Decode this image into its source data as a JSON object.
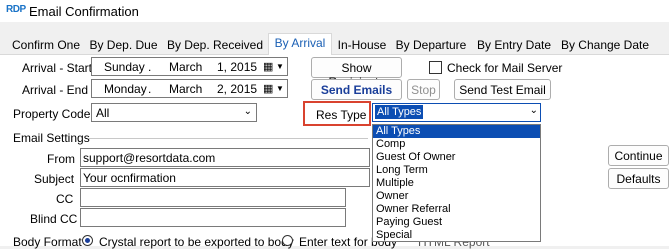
{
  "window": {
    "title": "Email Confirmation",
    "logo": "RDP"
  },
  "tabs": [
    {
      "label": "Confirm One"
    },
    {
      "label": "By Dep. Due"
    },
    {
      "label": "By Dep. Received"
    },
    {
      "label": "By Arrival"
    },
    {
      "label": "In-House"
    },
    {
      "label": "By Departure"
    },
    {
      "label": "By Entry Date"
    },
    {
      "label": "By Change Date"
    }
  ],
  "filters": {
    "arrival_start_label": "Arrival - Start",
    "arrival_start": {
      "weekday": "Sunday",
      "month": "March",
      "day": "1, 2015"
    },
    "arrival_end_label": "Arrival - End",
    "arrival_end": {
      "weekday": "Monday",
      "month": "March",
      "day": "2, 2015"
    },
    "property_code_label": "Property Code",
    "property_code_value": "All",
    "res_type_label": "Res Type",
    "res_type_value": "All Types",
    "res_type_options": [
      "All Types",
      "Comp",
      "Guest Of Owner",
      "Long Term",
      "Multiple",
      "Owner",
      "Owner Referral",
      "Paying Guest",
      "Special"
    ]
  },
  "buttons": {
    "show_recipients": "Show Recipients",
    "check_mail_server": "Check for Mail Server",
    "send_emails": "Send Emails",
    "stop": "Stop",
    "send_test_email": "Send Test Email",
    "continue": "Continue",
    "defaults": "Defaults"
  },
  "email_settings": {
    "section_label": "Email Settings",
    "from_label": "From",
    "from_value": "support@resortdata.com",
    "subject_label": "Subject",
    "subject_value": "Your ocnfirmation",
    "cc_label": "CC",
    "cc_value": "",
    "blind_cc_label": "Blind CC",
    "blind_cc_value": "",
    "body_format_label": "Body Format",
    "body_option_1": "Crystal report to be exported to body",
    "body_option_2": "Enter text for body",
    "body_option_3": "HTML Report"
  },
  "colors": {
    "accent": "#1a5fb4",
    "highlight_box": "#d9432f",
    "selection": "#0c4eb3"
  }
}
